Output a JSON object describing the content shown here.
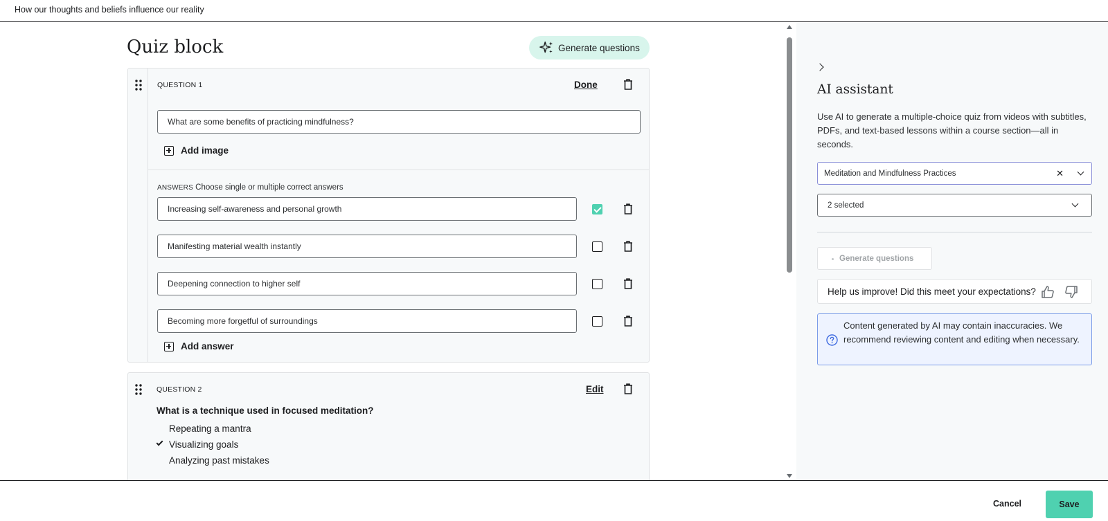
{
  "header": {
    "title": "How our thoughts and beliefs influence our reality"
  },
  "main": {
    "page_title": "Quiz block",
    "generate_label": "Generate questions",
    "question1": {
      "label": "QUESTION 1",
      "action": "Done",
      "question_value": "What are some benefits of practicing mindfulness?",
      "add_image": "Add image",
      "answers_cap": "ANSWERS",
      "answers_hint": "Choose single or multiple correct answers",
      "answers": [
        {
          "text": "Increasing self-awareness and personal growth",
          "correct": true
        },
        {
          "text": "Manifesting material wealth instantly",
          "correct": false
        },
        {
          "text": "Deepening connection to higher self",
          "correct": false
        },
        {
          "text": "Becoming more forgetful of surroundings",
          "correct": false
        }
      ],
      "add_answer": "Add answer"
    },
    "question2": {
      "label": "QUESTION 2",
      "action": "Edit",
      "question": "What is a technique used in focused meditation?",
      "options": [
        {
          "text": "Repeating a mantra",
          "correct": false
        },
        {
          "text": "Visualizing goals",
          "correct": true
        },
        {
          "text": "Analyzing past mistakes",
          "correct": false
        }
      ]
    }
  },
  "ai_panel": {
    "title": "AI assistant",
    "description": "Use AI to generate a multiple-choice quiz from videos with subtitles, PDFs, and text-based lessons within a course section—all in seconds.",
    "section_select": "Meditation and Mindfulness Practices",
    "clear_glyph": "✕",
    "lecture_select": "2 selected",
    "generate_label": "Generate questions",
    "feedback_prompt": "Help us improve! Did this meet your expectations?",
    "disclaimer": "Content generated by AI may contain inaccuracies. We recommend reviewing content and editing when necessary."
  },
  "footer": {
    "cancel": "Cancel",
    "save": "Save"
  },
  "colors": {
    "accent": "#4fd1b0",
    "accent_light": "#d8f5ec",
    "info_bg": "#eef3ff",
    "info_border": "#7b9ce8"
  }
}
